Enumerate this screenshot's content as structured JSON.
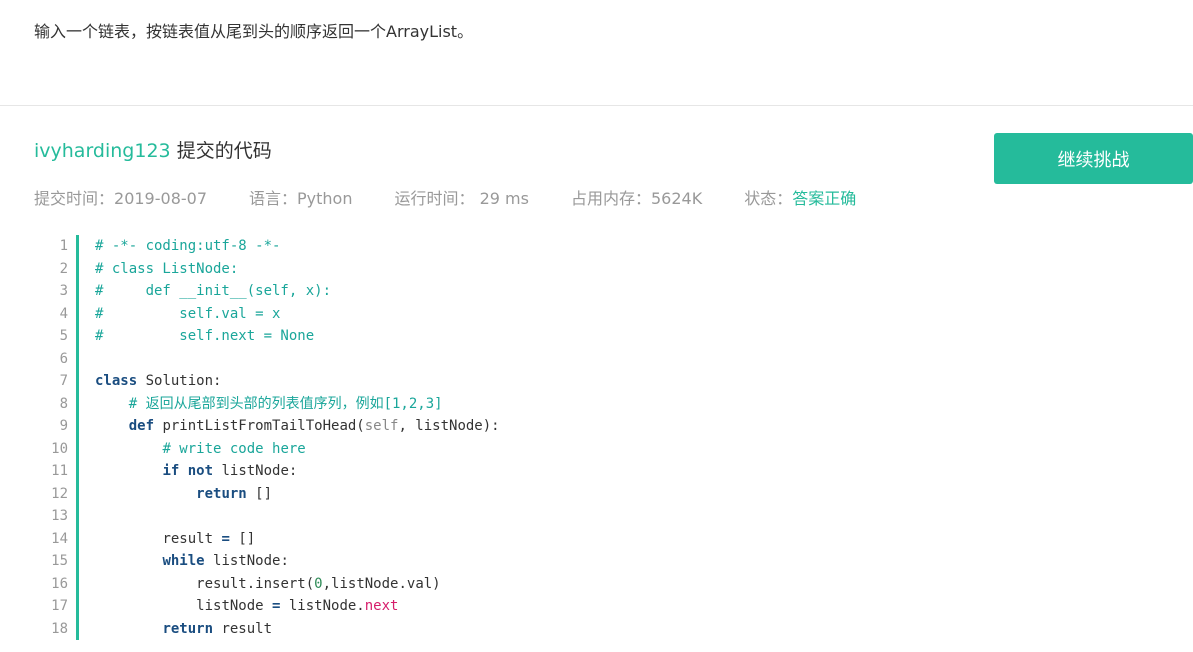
{
  "problem": {
    "text": "输入一个链表，按链表值从尾到头的顺序返回一个ArrayList。"
  },
  "submission": {
    "username": "ivyharding123",
    "title_suffix": "提交的代码",
    "continue_button": "继续挑战",
    "meta": {
      "submit_time_label": "提交时间：",
      "submit_time": "2019-08-07",
      "language_label": "语言：",
      "language": "Python",
      "run_time_label": "运行时间：",
      "run_time": " 29 ms",
      "memory_label": "占用内存：",
      "memory": "5624K",
      "status_label": "状态：",
      "status": "答案正确"
    }
  },
  "code": {
    "line_numbers": [
      "1",
      "2",
      "3",
      "4",
      "5",
      "6",
      "7",
      "8",
      "9",
      "10",
      "11",
      "12",
      "13",
      "14",
      "15",
      "16",
      "17",
      "18"
    ],
    "l1": "# -*- coding:utf-8 -*-",
    "l2": "# class ListNode:",
    "l3": "#     def __init__(self, x):",
    "l4": "#         self.val = x",
    "l5": "#         self.next = None",
    "l7_kw": "class",
    "l7_rest": " Solution:",
    "l8": "# 返回从尾部到头部的列表值序列，例如[1,2,3]",
    "l9_kw": "def",
    "l9_a": " printListFromTailToHead(",
    "l9_self": "self",
    "l9_b": ", listNode):",
    "l10": "# write code here",
    "l11_kw1": "if",
    "l11_kw2": "not",
    "l11_rest": " listNode:",
    "l12_kw": "return",
    "l12_rest": " []",
    "l14_a": "result ",
    "l14_op": "=",
    "l14_b": " []",
    "l15_kw": "while",
    "l15_rest": " listNode:",
    "l16_a": "result.insert(",
    "l16_num": "0",
    "l16_b": ",listNode.val)",
    "l17_a": "listNode ",
    "l17_op": "=",
    "l17_b": " listNode.",
    "l17_next": "next",
    "l18_kw": "return",
    "l18_rest": " result"
  }
}
